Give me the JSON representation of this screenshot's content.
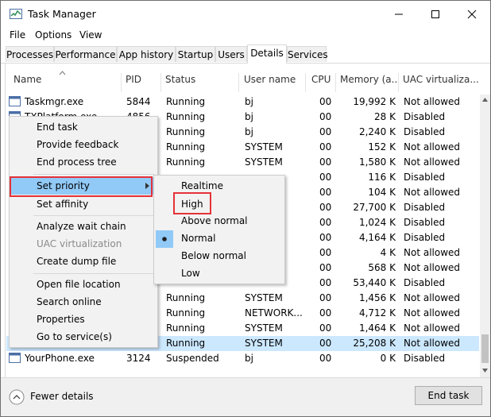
{
  "window": {
    "title": "Task Manager"
  },
  "menubar": [
    "File",
    "Options",
    "View"
  ],
  "tabs": [
    "Processes",
    "Performance",
    "App history",
    "Startup",
    "Users",
    "Details",
    "Services"
  ],
  "active_tab": "Details",
  "columns": [
    "Name",
    "PID",
    "Status",
    "User name",
    "CPU",
    "Memory (a...",
    "UAC virtualiza..."
  ],
  "rows": [
    {
      "name": "Taskmgr.exe",
      "pid": "5844",
      "status": "Running",
      "user": "bj",
      "cpu": "00",
      "mem": "19,992 K",
      "uac": "Not allowed"
    },
    {
      "name": "TXPlatform.exe",
      "pid": "4856",
      "status": "Running",
      "user": "bj",
      "cpu": "00",
      "mem": "28 K",
      "uac": "Disabled"
    },
    {
      "name": "",
      "pid": "",
      "status": "Running",
      "user": "bj",
      "cpu": "00",
      "mem": "2,240 K",
      "uac": "Disabled"
    },
    {
      "name": "",
      "pid": "",
      "status": "Running",
      "user": "SYSTEM",
      "cpu": "00",
      "mem": "152 K",
      "uac": "Not allowed"
    },
    {
      "name": "",
      "pid": "",
      "status": "Running",
      "user": "SYSTEM",
      "cpu": "00",
      "mem": "1,580 K",
      "uac": "Not allowed"
    },
    {
      "name": "",
      "pid": "",
      "status": "",
      "user": "",
      "cpu": "00",
      "mem": "116 K",
      "uac": "Disabled"
    },
    {
      "name": "",
      "pid": "",
      "status": "",
      "user": "",
      "cpu": "00",
      "mem": "104 K",
      "uac": "Not allowed"
    },
    {
      "name": "",
      "pid": "",
      "status": "",
      "user": "",
      "cpu": "00",
      "mem": "27,700 K",
      "uac": "Disabled"
    },
    {
      "name": "",
      "pid": "",
      "status": "",
      "user": "",
      "cpu": "00",
      "mem": "1,024 K",
      "uac": "Disabled"
    },
    {
      "name": "",
      "pid": "",
      "status": "",
      "user": "",
      "cpu": "00",
      "mem": "4,164 K",
      "uac": "Disabled"
    },
    {
      "name": "",
      "pid": "",
      "status": "",
      "user": "",
      "cpu": "00",
      "mem": "4 K",
      "uac": "Not allowed"
    },
    {
      "name": "",
      "pid": "",
      "status": "",
      "user": "",
      "cpu": "00",
      "mem": "568 K",
      "uac": "Not allowed"
    },
    {
      "name": "",
      "pid": "",
      "status": "",
      "user": "",
      "cpu": "00",
      "mem": "53,440 K",
      "uac": "Disabled"
    },
    {
      "name": "",
      "pid": "",
      "status": "Running",
      "user": "SYSTEM",
      "cpu": "00",
      "mem": "1,456 K",
      "uac": "Not allowed"
    },
    {
      "name": "",
      "pid": "",
      "status": "Running",
      "user": "NETWORK...",
      "cpu": "00",
      "mem": "4,712 K",
      "uac": "Not allowed"
    },
    {
      "name": "",
      "pid": "",
      "status": "Running",
      "user": "SYSTEM",
      "cpu": "00",
      "mem": "1,464 K",
      "uac": "Not allowed"
    },
    {
      "name": "",
      "pid": "",
      "status": "Running",
      "user": "SYSTEM",
      "cpu": "00",
      "mem": "25,208 K",
      "uac": "Not allowed",
      "selected": true
    },
    {
      "name": "YourPhone.exe",
      "pid": "3124",
      "status": "Suspended",
      "user": "bj",
      "cpu": "00",
      "mem": "0 K",
      "uac": "Disabled"
    }
  ],
  "context_menu": {
    "items": [
      "End task",
      "Provide feedback",
      "End process tree",
      "Set priority",
      "Set affinity",
      "Analyze wait chain",
      "UAC virtualization",
      "Create dump file",
      "Open file location",
      "Search online",
      "Properties",
      "Go to service(s)"
    ],
    "disabled": [
      "UAC virtualization"
    ],
    "highlighted": "Set priority"
  },
  "priority_submenu": {
    "items": [
      "Realtime",
      "High",
      "Above normal",
      "Normal",
      "Below normal",
      "Low"
    ],
    "checked": "Normal",
    "boxed": "High"
  },
  "footer": {
    "fewer_details": "Fewer details",
    "end_task": "End task"
  },
  "colors": {
    "selection": "#cce8ff",
    "menu_highlight": "#91c9f7",
    "annotation_box": "#e53238"
  }
}
